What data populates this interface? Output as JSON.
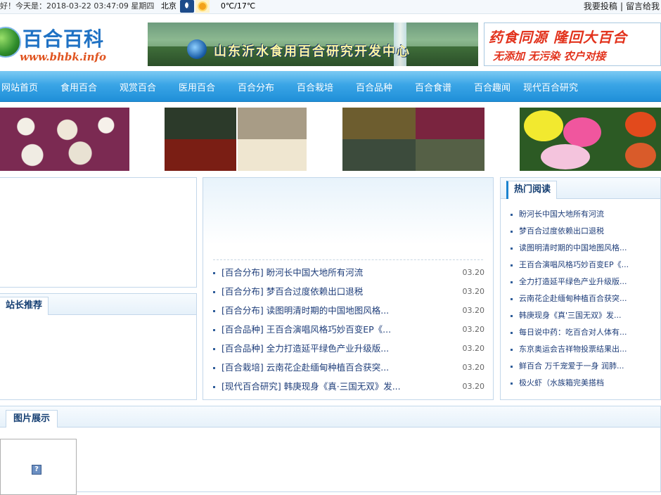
{
  "topbar": {
    "greeting": "好！今天是：2018-03-22 03:47:09 星期四",
    "city": "北京",
    "temperature": "0℃/17℃",
    "link_contribute": "我要投稿",
    "separator": "|",
    "link_message": "留言给我"
  },
  "header": {
    "logo_title": "百合百科",
    "logo_url": "www.bhbk.info",
    "banner_center_text": "山东沂水食用百合研究开发中心",
    "banner_right_line1": "药食同源 隆回大百合",
    "banner_right_line2": "无添加 无污染 农户对接"
  },
  "nav": {
    "items": [
      "网站首页",
      "食用百合",
      "观赏百合",
      "医用百合",
      "百合分布",
      "百合栽培",
      "百合品种",
      "百合食谱",
      "百合趣闻",
      "现代百合研究"
    ]
  },
  "sections": {
    "recommend_title": "站长推荐",
    "hot_title": "热门阅读",
    "gallery_title": "图片展示",
    "gallery_placeholder": "?"
  },
  "news": [
    {
      "title": "[百合分布] 盼河长中国大地所有河流",
      "date": "03.20"
    },
    {
      "title": "[百合分布] 梦百合过度依赖出口退税",
      "date": "03.20"
    },
    {
      "title": "[百合分布] 读图明清时期的中国地图风格...",
      "date": "03.20"
    },
    {
      "title": "[百合品种] 王百合演唱风格巧妙百变EP《...",
      "date": "03.20"
    },
    {
      "title": "[百合品种] 全力打造延平绿色产业升级版...",
      "date": "03.20"
    },
    {
      "title": "[百合栽培] 云南花企赴缅甸种植百合获突...",
      "date": "03.20"
    },
    {
      "title": "[现代百合研究] 韩庚现身《真·三国无双》发...",
      "date": "03.20"
    }
  ],
  "hot": [
    "盼河长中国大地所有河流",
    "梦百合过度依赖出口退税",
    "读图明清时期的中国地图风格...",
    "王百合演唱风格巧妙百变EP《...",
    "全力打造延平绿色产业升级版...",
    "云南花企赴缅甸种植百合获突...",
    "韩庚现身《真'三国无双》发...",
    "每日说中药：吃百合对人体有...",
    "东京奥运会吉祥物投票结果出...",
    "鲜百合 万千宠爱于一身 润肺...",
    "极火虾（水族箱完美搭档"
  ]
}
